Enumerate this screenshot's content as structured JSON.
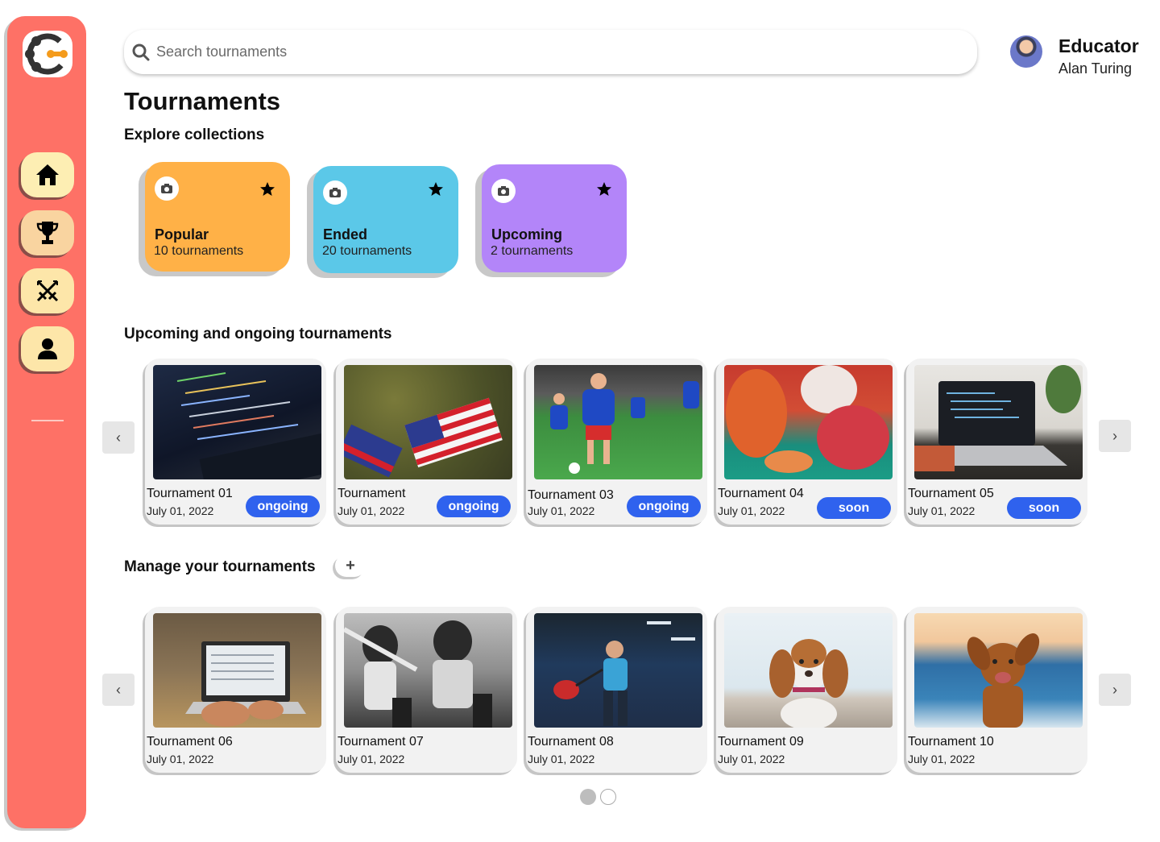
{
  "app": {
    "logo_icon": "app-logo-icon"
  },
  "sidebar": {
    "items": [
      {
        "name": "home",
        "icon": "home-icon"
      },
      {
        "name": "tournaments",
        "icon": "trophy-icon"
      },
      {
        "name": "battle",
        "icon": "crossed-swords-icon"
      },
      {
        "name": "profile",
        "icon": "user-icon"
      }
    ],
    "colors": {
      "background": "#fe7166",
      "button": "#fde6a9"
    }
  },
  "search": {
    "placeholder": "Search tournaments"
  },
  "user": {
    "role": "Educator",
    "name": "Alan Turing"
  },
  "page": {
    "title": "Tournaments"
  },
  "collections": {
    "heading": "Explore collections",
    "items": [
      {
        "name": "Popular",
        "count": "10 tournaments",
        "color": "#ffb147"
      },
      {
        "name": "Ended",
        "count": "20 tournaments",
        "color": "#5bc8e8"
      },
      {
        "name": "Upcoming",
        "count": "2 tournaments",
        "color": "#b385f9"
      }
    ]
  },
  "upcoming": {
    "heading": "Upcoming and ongoing tournaments",
    "cards": [
      {
        "name": "Tournament 01",
        "date": "July 01, 2022",
        "status": "ongoing"
      },
      {
        "name": "Tournament",
        "date": "July 01, 2022",
        "status": "ongoing"
      },
      {
        "name": "Tournament 03",
        "date": "July 01, 2022",
        "status": "ongoing"
      },
      {
        "name": "Tournament 04",
        "date": "July 01, 2022",
        "status": "soon"
      },
      {
        "name": "Tournament 05",
        "date": "July 01, 2022",
        "status": "soon"
      }
    ]
  },
  "manage": {
    "heading": "Manage your tournaments",
    "add_label": "+",
    "cards": [
      {
        "name": "Tournament 06",
        "date": "July 01, 2022"
      },
      {
        "name": "Tournament 07",
        "date": "July 01, 2022"
      },
      {
        "name": "Tournament 08",
        "date": "July 01, 2022"
      },
      {
        "name": "Tournament 09",
        "date": "July 01, 2022"
      },
      {
        "name": "Tournament 10",
        "date": "July 01, 2022"
      }
    ]
  },
  "carousel": {
    "prev_icon": "chevron-left-icon",
    "next_icon": "chevron-right-icon",
    "prev_glyph": "‹",
    "next_glyph": "›"
  },
  "pagination": {
    "pages": 2,
    "current": 1
  },
  "accent": "#2f62ee"
}
